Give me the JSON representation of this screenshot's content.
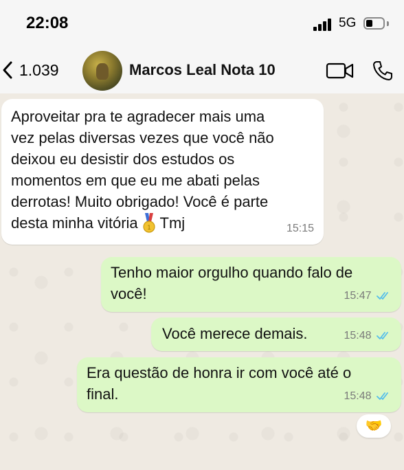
{
  "status_bar": {
    "time": "22:08",
    "network": "5G"
  },
  "header": {
    "back_count": "1.039",
    "contact_name": "Marcos Leal Nota 10"
  },
  "messages": [
    {
      "direction": "incoming",
      "lines": [
        "Aproveitar pra te agradecer mais uma",
        "vez pelas diversas vezes que você não",
        "deixou eu desistir dos estudos os",
        "momentos em que eu me abati pelas",
        "derrotas! Muito obrigado! Você é parte"
      ],
      "last_line_before": "desta minha vitória",
      "emoji": "🥇",
      "last_line_after": "Tmj",
      "time": "15:15"
    },
    {
      "direction": "outgoing",
      "lines": [
        "Tenho maior orgulho quando falo de",
        "você!"
      ],
      "time": "15:47",
      "status": "read"
    },
    {
      "direction": "outgoing",
      "lines": [
        "Você merece demais."
      ],
      "time": "15:48",
      "status": "read"
    },
    {
      "direction": "outgoing",
      "lines": [
        "Era questão de honra ir com você até o",
        "final."
      ],
      "time": "15:48",
      "status": "read"
    }
  ],
  "reaction": {
    "emoji": "🤝"
  },
  "colors": {
    "outgoing_bubble": "#dcf8c6",
    "incoming_bubble": "#ffffff",
    "read_ticks": "#53bdeb",
    "background": "#efeae2"
  },
  "icons": [
    "back-chevron-icon",
    "video-call-icon",
    "phone-call-icon",
    "signal-icon",
    "battery-icon",
    "medal-icon",
    "read-ticks-icon"
  ]
}
